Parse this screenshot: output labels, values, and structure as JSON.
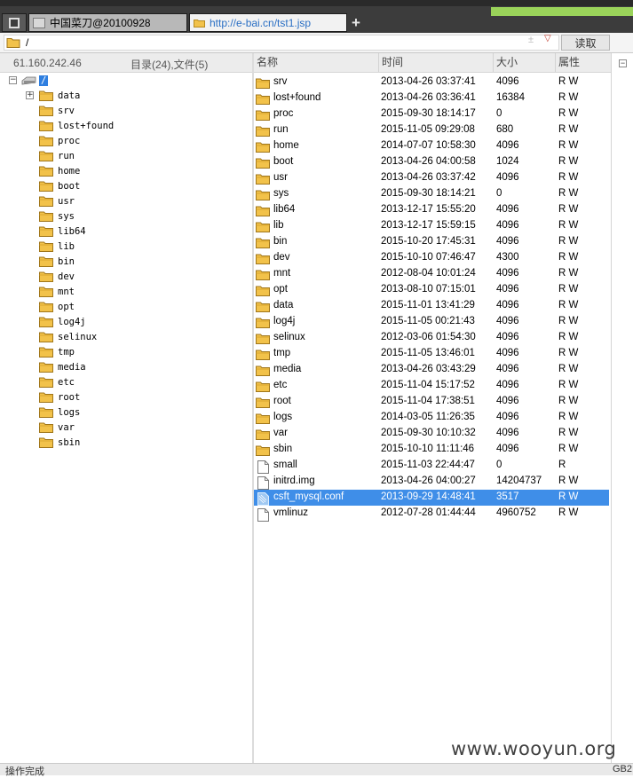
{
  "tabs": {
    "caidao_label": "中国菜刀@20100928",
    "url_label": "http://e-bai.cn/tst1.jsp",
    "add_label": "+"
  },
  "pathbar": {
    "path": "/",
    "extra": "±",
    "dropdown": "▽",
    "read_label": "读取"
  },
  "left_header": {
    "ip": "61.160.242.46",
    "count": "目录(24),文件(5)"
  },
  "columns": {
    "name": "名称",
    "time": "时间",
    "size": "大小",
    "attr": "属性"
  },
  "tree": {
    "root_label": "/",
    "expander_root": "−",
    "expander_data": "+",
    "children": [
      "data",
      "srv",
      "lost+found",
      "proc",
      "run",
      "home",
      "boot",
      "usr",
      "sys",
      "lib64",
      "lib",
      "bin",
      "dev",
      "mnt",
      "opt",
      "log4j",
      "selinux",
      "tmp",
      "media",
      "etc",
      "root",
      "logs",
      "var",
      "sbin"
    ]
  },
  "files": [
    {
      "name": "srv",
      "time": "2013-04-26 03:37:41",
      "size": "4096",
      "attr": "R W",
      "type": "folder"
    },
    {
      "name": "lost+found",
      "time": "2013-04-26 03:36:41",
      "size": "16384",
      "attr": "R W",
      "type": "folder"
    },
    {
      "name": "proc",
      "time": "2015-09-30 18:14:17",
      "size": "0",
      "attr": "R W",
      "type": "folder"
    },
    {
      "name": "run",
      "time": "2015-11-05 09:29:08",
      "size": "680",
      "attr": "R W",
      "type": "folder"
    },
    {
      "name": "home",
      "time": "2014-07-07 10:58:30",
      "size": "4096",
      "attr": "R W",
      "type": "folder"
    },
    {
      "name": "boot",
      "time": "2013-04-26 04:00:58",
      "size": "1024",
      "attr": "R W",
      "type": "folder"
    },
    {
      "name": "usr",
      "time": "2013-04-26 03:37:42",
      "size": "4096",
      "attr": "R W",
      "type": "folder"
    },
    {
      "name": "sys",
      "time": "2015-09-30 18:14:21",
      "size": "0",
      "attr": "R W",
      "type": "folder"
    },
    {
      "name": "lib64",
      "time": "2013-12-17 15:55:20",
      "size": "4096",
      "attr": "R W",
      "type": "folder"
    },
    {
      "name": "lib",
      "time": "2013-12-17 15:59:15",
      "size": "4096",
      "attr": "R W",
      "type": "folder"
    },
    {
      "name": "bin",
      "time": "2015-10-20 17:45:31",
      "size": "4096",
      "attr": "R W",
      "type": "folder"
    },
    {
      "name": "dev",
      "time": "2015-10-10 07:46:47",
      "size": "4300",
      "attr": "R W",
      "type": "folder"
    },
    {
      "name": "mnt",
      "time": "2012-08-04 10:01:24",
      "size": "4096",
      "attr": "R W",
      "type": "folder"
    },
    {
      "name": "opt",
      "time": "2013-08-10 07:15:01",
      "size": "4096",
      "attr": "R W",
      "type": "folder"
    },
    {
      "name": "data",
      "time": "2015-11-01 13:41:29",
      "size": "4096",
      "attr": "R W",
      "type": "folder"
    },
    {
      "name": "log4j",
      "time": "2015-11-05 00:21:43",
      "size": "4096",
      "attr": "R W",
      "type": "folder"
    },
    {
      "name": "selinux",
      "time": "2012-03-06 01:54:30",
      "size": "4096",
      "attr": "R W",
      "type": "folder"
    },
    {
      "name": "tmp",
      "time": "2015-11-05 13:46:01",
      "size": "4096",
      "attr": "R W",
      "type": "folder"
    },
    {
      "name": "media",
      "time": "2013-04-26 03:43:29",
      "size": "4096",
      "attr": "R W",
      "type": "folder"
    },
    {
      "name": "etc",
      "time": "2015-11-04 15:17:52",
      "size": "4096",
      "attr": "R W",
      "type": "folder"
    },
    {
      "name": "root",
      "time": "2015-11-04 17:38:51",
      "size": "4096",
      "attr": "R W",
      "type": "folder"
    },
    {
      "name": "logs",
      "time": "2014-03-05 11:26:35",
      "size": "4096",
      "attr": "R W",
      "type": "folder"
    },
    {
      "name": "var",
      "time": "2015-09-30 10:10:32",
      "size": "4096",
      "attr": "R W",
      "type": "folder"
    },
    {
      "name": "sbin",
      "time": "2015-10-10 11:11:46",
      "size": "4096",
      "attr": "R W",
      "type": "folder"
    },
    {
      "name": "small",
      "time": "2015-11-03 22:44:47",
      "size": "0",
      "attr": "R",
      "type": "file"
    },
    {
      "name": "initrd.img",
      "time": "2013-04-26 04:00:27",
      "size": "14204737",
      "attr": "R W",
      "type": "file"
    },
    {
      "name": "csft_mysql.conf",
      "time": "2013-09-29 14:48:41",
      "size": "3517",
      "attr": "R W",
      "type": "file-selected",
      "selected": true
    },
    {
      "name": "vmlinuz",
      "time": "2012-07-28 01:44:44",
      "size": "4960752",
      "attr": "R W",
      "type": "file"
    }
  ],
  "right_strip": {
    "expander": "−"
  },
  "status": {
    "text": "操作完成",
    "encoding": "GB2"
  },
  "watermark": "www.wooyun.org",
  "colors": {
    "selection": "#3f8ee8",
    "folder": "#f2c24a",
    "url_text": "#2a6fc4"
  },
  "icons": {
    "folder": "folder-icon",
    "file": "file-icon",
    "drive": "drive-icon"
  }
}
